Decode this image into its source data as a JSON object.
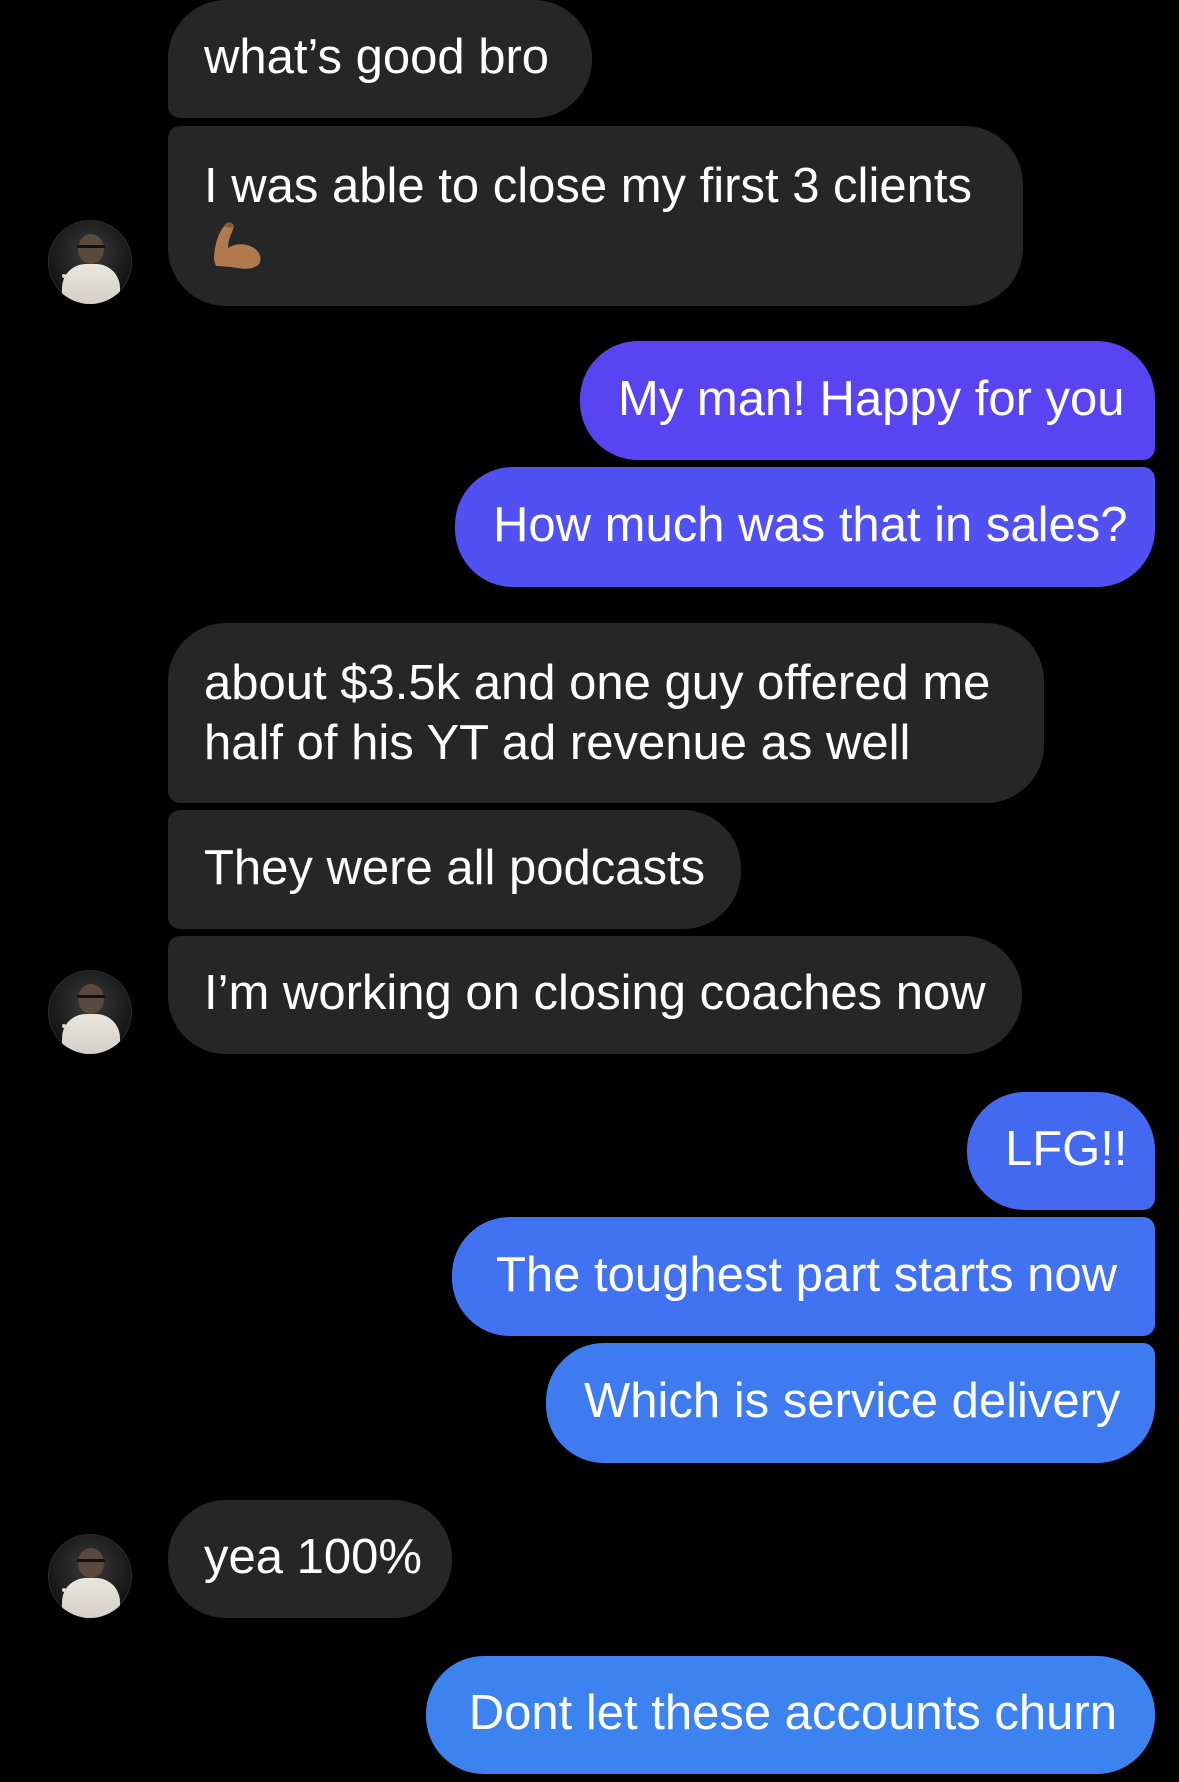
{
  "colors": {
    "incoming_bubble": "#262626",
    "outgoing_gradient_top": "#5B44F0",
    "outgoing_gradient_bottom": "#3F7DF0",
    "background": "#000000",
    "text": "#ffffff"
  },
  "messages": [
    {
      "direction": "incoming",
      "text": "what’s good bro"
    },
    {
      "direction": "incoming",
      "text": "I was able to close my first 3 clients",
      "emoji": "flexed-biceps"
    },
    {
      "direction": "outgoing",
      "text": "My man! Happy for you"
    },
    {
      "direction": "outgoing",
      "text": "How much was that in sales?"
    },
    {
      "direction": "incoming",
      "line1": "about $3.5k and one guy offered me",
      "line2": "half of his YT ad revenue as well"
    },
    {
      "direction": "incoming",
      "text": "They were all podcasts"
    },
    {
      "direction": "incoming",
      "text": "I’m working on closing coaches now"
    },
    {
      "direction": "outgoing",
      "text": "LFG!!"
    },
    {
      "direction": "outgoing",
      "text": "The toughest part starts now"
    },
    {
      "direction": "outgoing",
      "text": "Which is service delivery"
    },
    {
      "direction": "incoming",
      "text": "yea 100%"
    },
    {
      "direction": "outgoing",
      "text": "Dont let these accounts churn"
    }
  ],
  "avatar": {
    "icon": "profile-photo"
  }
}
